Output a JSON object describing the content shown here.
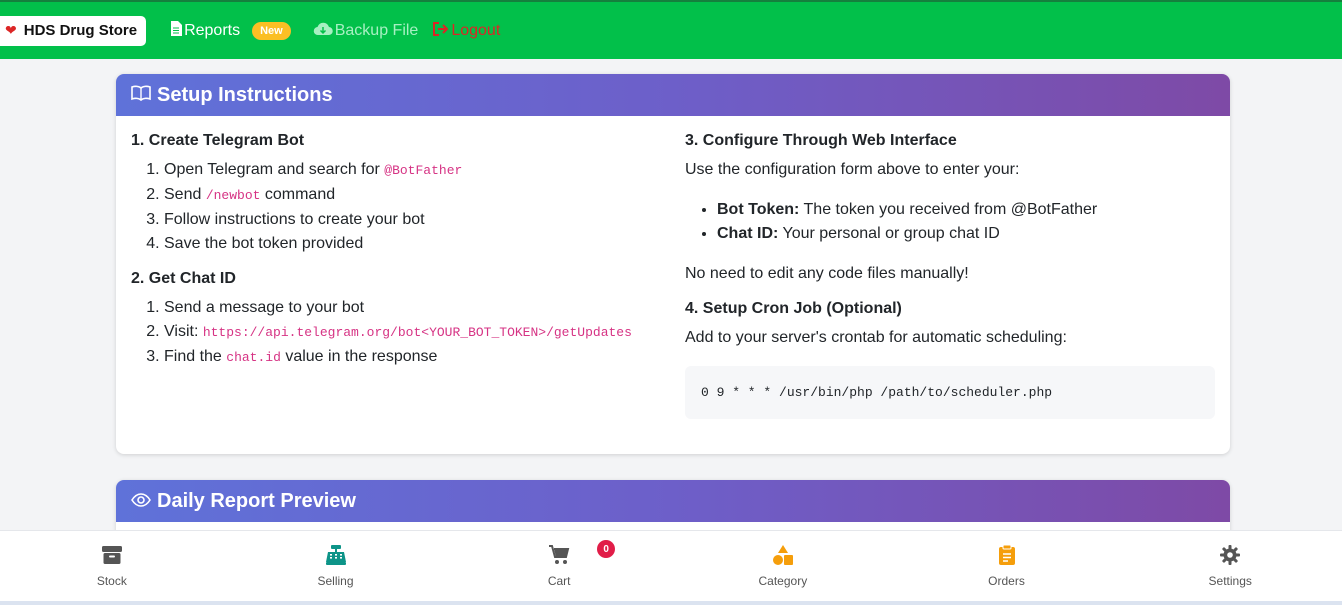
{
  "nav": {
    "brand": "HDS Drug Store",
    "reports": "Reports",
    "new_badge": "New",
    "backup": "Backup File",
    "logout": "Logout"
  },
  "setup": {
    "title": "Setup Instructions",
    "s1_title": "1. Create Telegram Bot",
    "s1_i1_text": "Open Telegram and search for ",
    "s1_i1_code": "@BotFather",
    "s1_i2_pre": "Send ",
    "s1_i2_code": "/newbot",
    "s1_i2_post": " command",
    "s1_i3": "Follow instructions to create your bot",
    "s1_i4": "Save the bot token provided",
    "s2_title": "2. Get Chat ID",
    "s2_i1": "Send a message to your bot",
    "s2_i2_pre": "Visit: ",
    "s2_i2_code": "https://api.telegram.org/bot<YOUR_BOT_TOKEN>/getUpdates",
    "s2_i3_pre": "Find the ",
    "s2_i3_code": "chat.id",
    "s2_i3_post": " value in the response",
    "s3_title": "3. Configure Through Web Interface",
    "s3_intro": "Use the configuration form above to enter your:",
    "s3_b1_label": "Bot Token:",
    "s3_b1_text": " The token you received from @BotFather",
    "s3_b2_label": "Chat ID:",
    "s3_b2_text": " Your personal or group chat ID",
    "s3_note": "No need to edit any code files manually!",
    "s4_title": "4. Setup Cron Job (Optional)",
    "s4_intro": "Add to your server's crontab for automatic scheduling:",
    "s4_code": "0 9 * * * /usr/bin/php /path/to/scheduler.php"
  },
  "preview": {
    "title": "Daily Report Preview"
  },
  "bottom": {
    "stock": "Stock",
    "selling": "Selling",
    "cart": "Cart",
    "cart_count": "0",
    "category": "Category",
    "orders": "Orders",
    "settings": "Settings"
  },
  "colors": {
    "nav_green": "#02c04a",
    "gradient_start": "#5f72d9",
    "gradient_end": "#7e4aa6",
    "selling_icon": "#0d9488",
    "category_icon": "#f59e0b",
    "orders_icon": "#f59e0b"
  }
}
